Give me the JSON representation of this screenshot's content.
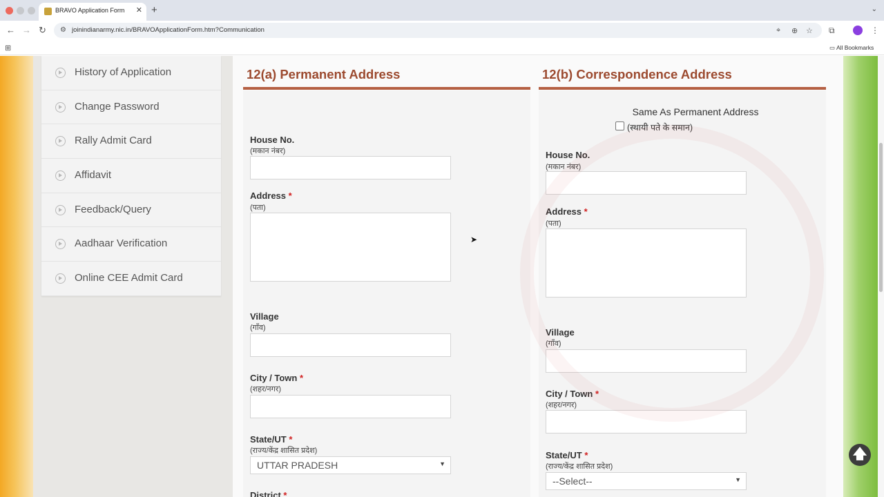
{
  "browser": {
    "tab_title": "BRAVO Application Form",
    "url": "joinindianarmy.nic.in/BRAVOApplicationForm.htm?Communication",
    "bookmarks_label": "All Bookmarks"
  },
  "sidebar": {
    "items": [
      {
        "label": "History of Application"
      },
      {
        "label": "Change Password"
      },
      {
        "label": "Rally Admit Card"
      },
      {
        "label": "Affidavit"
      },
      {
        "label": "Feedback/Query"
      },
      {
        "label": "Aadhaar Verification"
      },
      {
        "label": "Online CEE Admit Card"
      }
    ]
  },
  "permanent": {
    "title": "12(a) Permanent Address",
    "house_label": "House No.",
    "house_sub": "(मकान नंबर)",
    "address_label": "Address",
    "address_sub": "(पता)",
    "village_label": "Village",
    "village_sub": "(गाँव)",
    "city_label": "City / Town",
    "city_sub": "(शहर/नगर)",
    "state_label": "State/UT",
    "state_sub": "(राज्य/केंद्र शासित प्रदेश)",
    "state_value": "UTTAR PRADESH",
    "district_label": "District"
  },
  "correspondence": {
    "title": "12(b) Correspondence Address",
    "same_as_label": "Same As Permanent Address",
    "same_as_sub": "(स्थायी पते के समान)",
    "house_label": "House No.",
    "house_sub": "(मकान नंबर)",
    "address_label": "Address",
    "address_sub": "(पता)",
    "village_label": "Village",
    "village_sub": "(गाँव)",
    "city_label": "City / Town",
    "city_sub": "(शहर/नगर)",
    "state_label": "State/UT",
    "state_sub": "(राज्य/केंद्र शासित प्रदेश)",
    "state_value": "--Select--"
  },
  "required_mark": "*",
  "colors": {
    "section_title": "#9c4a2f",
    "section_rule": "#b56043",
    "required": "#d02020"
  }
}
